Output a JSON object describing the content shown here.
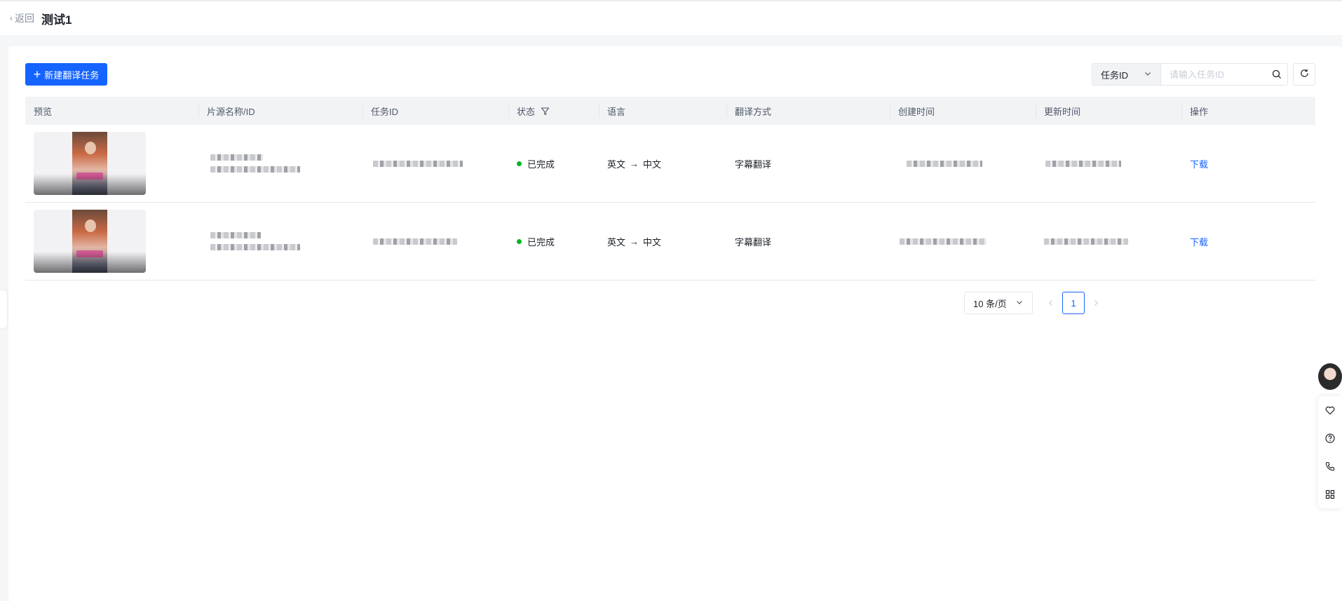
{
  "header": {
    "back_label": "返回",
    "title": "测试1"
  },
  "toolbar": {
    "new_task_label": "新建翻译任务",
    "search_field_selected": "任务ID",
    "search_placeholder": "请输入任务ID",
    "search_icon": "search-icon",
    "refresh_icon": "refresh-icon"
  },
  "table": {
    "columns": [
      "预览",
      "片源名称/ID",
      "任务ID",
      "状态",
      "语言",
      "翻译方式",
      "创建时间",
      "更新时间",
      "操作"
    ],
    "rows": [
      {
        "status": "已完成",
        "lang_from": "英文",
        "lang_arrow": "→",
        "lang_to": "中文",
        "method": "字幕翻译",
        "action": "下载"
      },
      {
        "status": "已完成",
        "lang_from": "英文",
        "lang_arrow": "→",
        "lang_to": "中文",
        "method": "字幕翻译",
        "action": "下载"
      }
    ]
  },
  "pagination": {
    "page_size_label": "10 条/页",
    "current_page": "1"
  },
  "colors": {
    "accent": "#1664ff",
    "status_success": "#00b42a",
    "header_bg": "#f2f3f5"
  },
  "side_tools": [
    "heart-icon",
    "question-icon",
    "phone-icon",
    "grid-icon"
  ]
}
